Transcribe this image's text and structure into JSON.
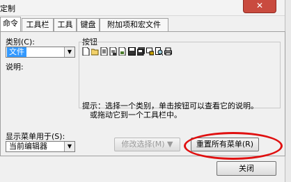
{
  "window": {
    "title": "定制",
    "close_glyph": "✕"
  },
  "tabs": [
    {
      "label": "命令",
      "active": true
    },
    {
      "label": "工具栏",
      "active": false
    },
    {
      "label": "工具",
      "active": false
    },
    {
      "label": "键盘",
      "active": false
    },
    {
      "label": "附加项和宏文件",
      "active": false
    }
  ],
  "category": {
    "label": "类别(C):",
    "value": "文件"
  },
  "buttons_group": {
    "label": "按钮",
    "icons": [
      "new-icon",
      "open-icon",
      "document-icon",
      "save-as-icon",
      "document2-icon",
      "save-icon",
      "save-all-icon",
      "print-setup-icon",
      "preview-icon",
      "print-icon"
    ]
  },
  "description_label": "说明:",
  "hint_lines": [
    "提示：选择一个类别，单击按钮可以查看它的说明。",
    "　或拖动它到一个工具栏中。"
  ],
  "show_menu": {
    "label": "显示菜单用于(S):",
    "value": "当前编辑器"
  },
  "modify_button": "修改选择(M)  ▼",
  "reset_button": "重置所有菜单(R)",
  "close_button": "关闭",
  "colors": {
    "highlight": "#3399ff",
    "annotation": "#e01010",
    "close": "#c94b3f"
  }
}
